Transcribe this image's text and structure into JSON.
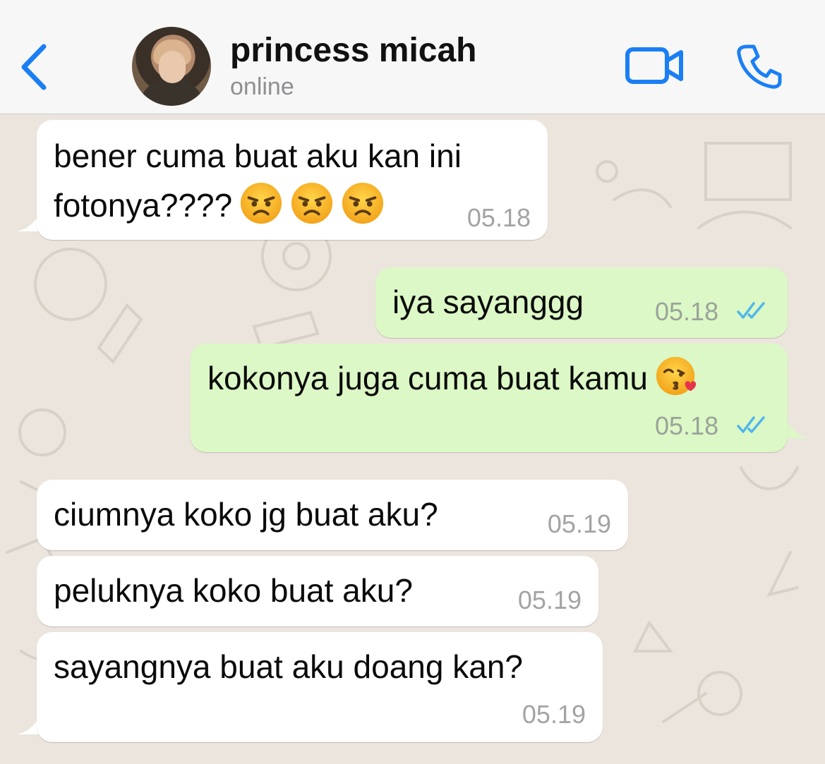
{
  "header": {
    "contact_name": "princess micah",
    "status": "online",
    "back_icon": "chevron-left-icon",
    "video_icon": "video-camera-icon",
    "call_icon": "phone-icon",
    "accent_color": "#1a7ff5"
  },
  "messages": [
    {
      "direction": "in",
      "lines": [
        "bener cuma buat aku kan ini",
        "fotonya????"
      ],
      "emojis": [
        "angry-face",
        "angry-face",
        "angry-face"
      ],
      "time": "05.18"
    },
    {
      "direction": "out",
      "text": "iya sayanggg",
      "time": "05.18",
      "read": true
    },
    {
      "direction": "out",
      "text": "kokonya juga cuma buat kamu",
      "emojis": [
        "face-blowing-kiss"
      ],
      "time": "05.18",
      "read": true
    },
    {
      "direction": "in",
      "text": "ciumnya koko jg buat aku?",
      "time": "05.19"
    },
    {
      "direction": "in",
      "text": "peluknya koko buat aku?",
      "time": "05.19"
    },
    {
      "direction": "in",
      "text": "sayangnya buat aku doang kan?",
      "time": "05.19"
    }
  ],
  "colors": {
    "incoming_bubble": "#ffffff",
    "outgoing_bubble": "#dcf8c6",
    "read_ticks": "#4fb6ec",
    "chat_background": "#ece5dd"
  }
}
